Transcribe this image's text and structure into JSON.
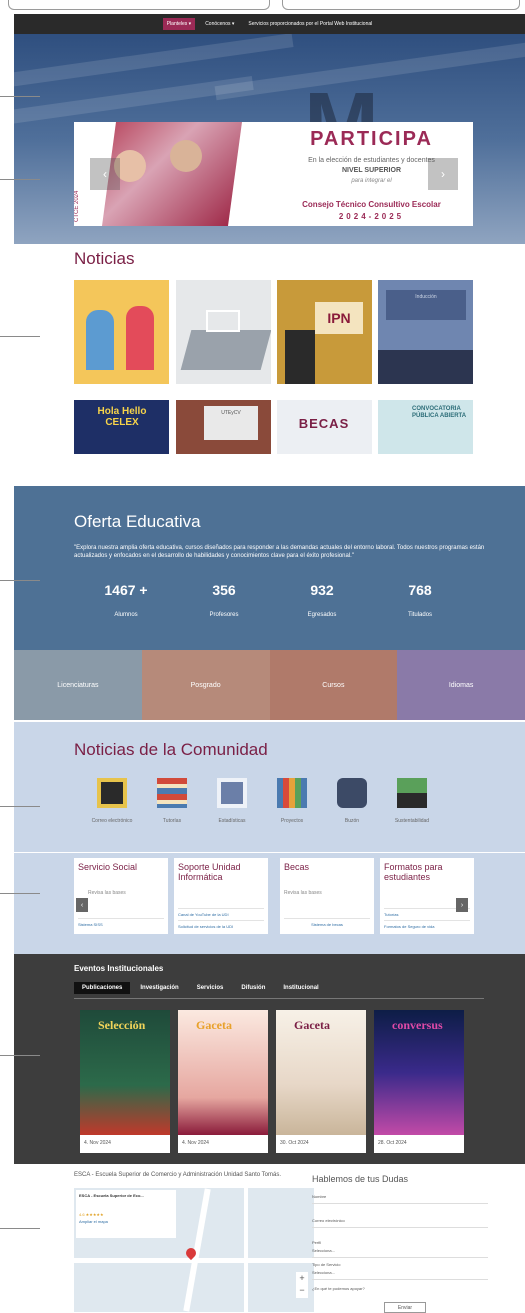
{
  "nav": {
    "items": [
      "Planteles ▾",
      "Conócenos ▾",
      "Servicios proporcionados por el Portal Web Institucional"
    ]
  },
  "hero": {
    "banner": {
      "title": "PARTICIPA",
      "line1": "En la elección de estudiantes y docentes",
      "line2": "NIVEL SUPERIOR",
      "line3": "para integrar el",
      "line4": "Consejo Técnico Consultivo Escolar",
      "line5": "2024-2025",
      "side_text": "CTCE 2024"
    },
    "prev": "‹",
    "next": "›"
  },
  "noticias": {
    "title": "Noticias",
    "thumb_texts": [
      "IPN",
      "Inducción",
      "Hola Hello CELEX",
      "UTEyCV",
      "BECAS",
      "CONVOCATORIA PÚBLICA ABIERTA"
    ]
  },
  "oferta": {
    "title": "Oferta Educativa",
    "description": "\"Explora nuestra amplia oferta educativa, cursos diseñados para responder a las demandas actuales del entorno laboral. Todos nuestros programas están actualizados y enfocados en el desarrollo de habilidades y conocimientos clave para el éxito profesional.\"",
    "stats": [
      {
        "num": "1467 +",
        "label": "Alumnos"
      },
      {
        "num": "356",
        "label": "Profesores"
      },
      {
        "num": "932",
        "label": "Egresados"
      },
      {
        "num": "768",
        "label": "Titulados"
      }
    ],
    "categories": [
      "Licenciaturas",
      "Posgrado",
      "Cursos",
      "Idiomas"
    ]
  },
  "comunidad": {
    "title": "Noticias de la Comunidad",
    "icons": [
      "Correo electrónico",
      "Tutorías",
      "Estadísticas",
      "Proyectos",
      "Buzón",
      "Sustentabilidad"
    ],
    "cards": [
      {
        "title": "Servicio Social",
        "sub": "Revisa las bases",
        "link": "Sistema SISS"
      },
      {
        "title": "Soporte Unidad Informática",
        "sub": "",
        "link1": "Canal de YouTube de la UDI",
        "link2": "Solicitud de servicios de la UDI"
      },
      {
        "title": "Becas",
        "sub": "Revisa las bases",
        "link": "Sistema de becas"
      },
      {
        "title": "Formatos para estudiantes",
        "sub": "",
        "link1": "Tutorías",
        "link2": "Formatos de Seguro de vida"
      }
    ]
  },
  "eventos": {
    "title": "Eventos Institucionales",
    "tabs": [
      "Publicaciones",
      "Investigación",
      "Servicios",
      "Difusión",
      "Institucional"
    ],
    "items": [
      {
        "cover": "Selección",
        "date": "4. Nov 2024"
      },
      {
        "cover": "Gaceta",
        "date": "4. Nov 2024"
      },
      {
        "cover": "Gaceta",
        "date": "30. Oct 2024"
      },
      {
        "cover": "conversus",
        "date": "28. Oct 2024"
      }
    ]
  },
  "footer": {
    "address": "ESCA - Escuela Superior de Comercio y Administración Unidad Santo Tomás.",
    "map_info_title": "ESCA - Escuela Superior de Eco...",
    "map_rating": "4.6 ★★★★★",
    "map_link": "Ampliar el mapa",
    "form_title": "Hablemos de tus Dudas",
    "fields": [
      "Nombre",
      "Correo electrónico",
      "Perfil",
      "Tipo de Servicio",
      "¿En qué te podemos apoyar?"
    ],
    "select_placeholder": "Selecciona...",
    "submit": "Enviar"
  }
}
